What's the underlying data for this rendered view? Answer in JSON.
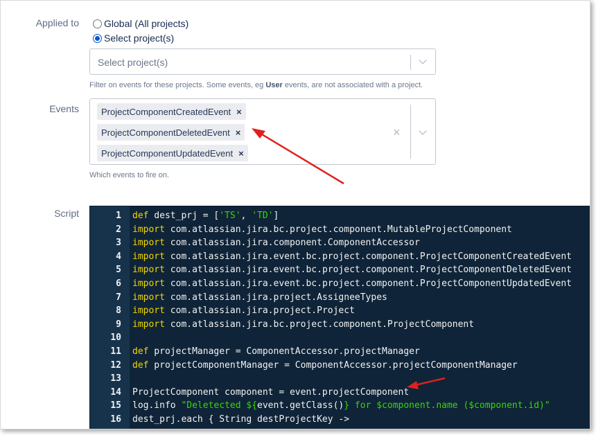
{
  "applied_to": {
    "label": "Applied to",
    "options": [
      {
        "label": "Global (All projects)",
        "checked": false
      },
      {
        "label": "Select project(s)",
        "checked": true
      }
    ]
  },
  "projects_select": {
    "placeholder": "Select project(s)",
    "help_pre": "Filter on events for these projects. Some events, eg ",
    "help_bold": "User",
    "help_post": " events, are not associated with a project."
  },
  "events": {
    "label": "Events",
    "tags": [
      {
        "label": "ProjectComponentCreatedEvent",
        "remove": "×"
      },
      {
        "label": "ProjectComponentDeletedEvent",
        "remove": "×"
      },
      {
        "label": "ProjectComponentUpdatedEvent",
        "remove": "×"
      }
    ],
    "clear": "×",
    "help": "Which events to fire on."
  },
  "script": {
    "label": "Script",
    "lines": [
      {
        "n": "1",
        "parts": [
          {
            "t": "def",
            "c": "kw"
          },
          {
            "t": " dest_prj = ["
          },
          {
            "t": "'TS'",
            "c": "str"
          },
          {
            "t": ", "
          },
          {
            "t": "'TD'",
            "c": "str"
          },
          {
            "t": "]"
          }
        ]
      },
      {
        "n": "2",
        "parts": [
          {
            "t": "import",
            "c": "kw"
          },
          {
            "t": " com.atlassian.jira.bc.project.component.MutableProjectComponent"
          }
        ]
      },
      {
        "n": "3",
        "parts": [
          {
            "t": "import",
            "c": "kw"
          },
          {
            "t": " com.atlassian.jira.component.ComponentAccessor"
          }
        ]
      },
      {
        "n": "4",
        "parts": [
          {
            "t": "import",
            "c": "kw"
          },
          {
            "t": " com.atlassian.jira.event.bc.project.component.ProjectComponentCreatedEvent"
          }
        ]
      },
      {
        "n": "5",
        "parts": [
          {
            "t": "import",
            "c": "kw"
          },
          {
            "t": " com.atlassian.jira.event.bc.project.component.ProjectComponentDeletedEvent"
          }
        ]
      },
      {
        "n": "6",
        "parts": [
          {
            "t": "import",
            "c": "kw"
          },
          {
            "t": " com.atlassian.jira.event.bc.project.component.ProjectComponentUpdatedEvent"
          }
        ]
      },
      {
        "n": "7",
        "parts": [
          {
            "t": "import",
            "c": "kw"
          },
          {
            "t": " com.atlassian.jira.project.AssigneeTypes"
          }
        ]
      },
      {
        "n": "8",
        "parts": [
          {
            "t": "import",
            "c": "kw"
          },
          {
            "t": " com.atlassian.jira.project.Project"
          }
        ]
      },
      {
        "n": "9",
        "parts": [
          {
            "t": "import",
            "c": "kw"
          },
          {
            "t": " com.atlassian.jira.bc.project.component.ProjectComponent"
          }
        ]
      },
      {
        "n": "10",
        "parts": []
      },
      {
        "n": "11",
        "parts": [
          {
            "t": "def",
            "c": "kw"
          },
          {
            "t": " projectManager = ComponentAccessor.projectManager"
          }
        ]
      },
      {
        "n": "12",
        "parts": [
          {
            "t": "def",
            "c": "kw"
          },
          {
            "t": " projectComponentManager = ComponentAccessor.projectComponentManager"
          }
        ]
      },
      {
        "n": "13",
        "parts": []
      },
      {
        "n": "14",
        "parts": [
          {
            "t": "ProjectComponent component = event.projectComponent"
          }
        ]
      },
      {
        "n": "15",
        "parts": [
          {
            "t": "log.info "
          },
          {
            "t": "\"Deletected ${",
            "c": "str"
          },
          {
            "t": "event.getClass()"
          },
          {
            "t": "} for $component.name ($component.id)\"",
            "c": "str"
          }
        ]
      },
      {
        "n": "16",
        "parts": [
          {
            "t": "dest_prj.each { String destProjectKey ->"
          }
        ]
      }
    ]
  },
  "colors": {
    "editor_bg": "#0f2438",
    "gutter_bg": "#17334c",
    "keyword": "#f0d800",
    "string": "#3ad600",
    "arrow": "#e02020"
  }
}
